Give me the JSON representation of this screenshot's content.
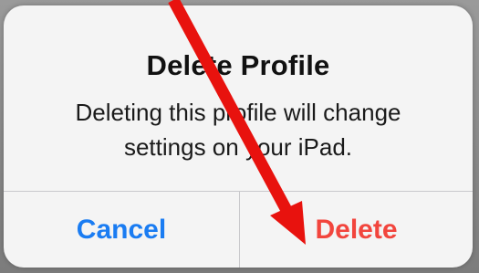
{
  "alert": {
    "title": "Delete Profile",
    "message": "Deleting this profile will change settings on your iPad.",
    "buttons": {
      "cancel": {
        "label": "Cancel",
        "color": "#1a7cf2"
      },
      "delete": {
        "label": "Delete",
        "color": "#f2453d"
      }
    }
  },
  "annotation": {
    "type": "arrow",
    "color": "#e8120e",
    "points_to": "delete-button"
  }
}
